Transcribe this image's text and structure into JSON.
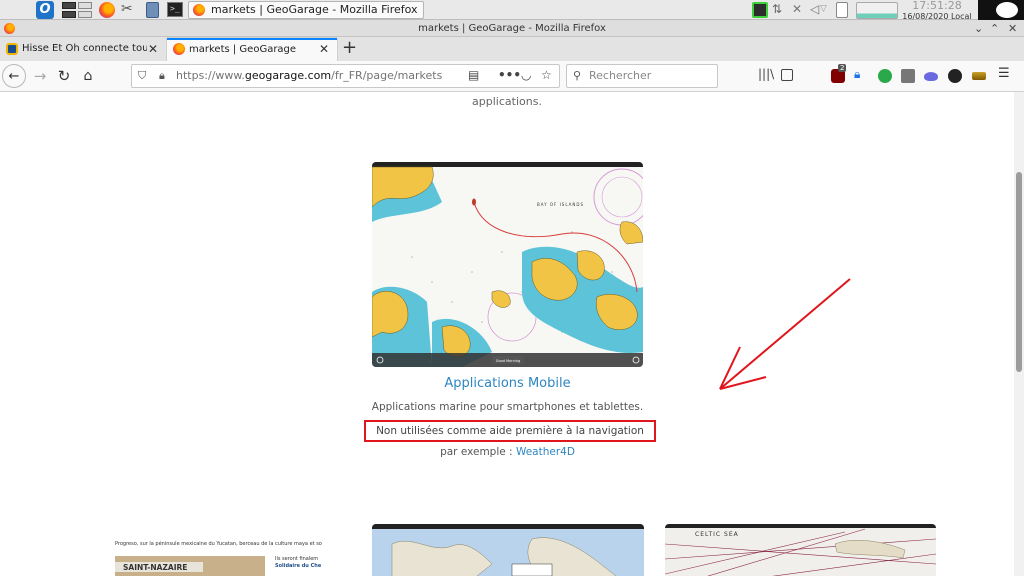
{
  "system_panel": {
    "taskbar_title": "markets | GeoGarage - Mozilla Firefox",
    "clock_time": "17:51:28",
    "clock_date": "16/08/2020 Local"
  },
  "window": {
    "title": "markets | GeoGarage - Mozilla Firefox"
  },
  "tabs": [
    {
      "label": "Hisse Et Oh connecte tous les",
      "active": false
    },
    {
      "label": "markets | GeoGarage",
      "active": true
    }
  ],
  "nav": {
    "url_prefix": "https://www.",
    "url_domain": "geogarage.com",
    "url_path": "/fr_FR/page/markets",
    "search_placeholder": "Rechercher",
    "badge_count": "2"
  },
  "page": {
    "intro_tail": "applications.",
    "feature": {
      "map_label": "BAY OF ISLANDS",
      "map_button": "Good Morning",
      "title": "Applications Mobile",
      "description": "Applications marine pour smartphones et tablettes.",
      "warning": "Non utilisées comme aide première à la navigation",
      "example_prefix": "par exemple : ",
      "example_link": "Weather4D"
    },
    "thumbnails": {
      "left_caption": "SAINT-NAZAIRE",
      "left_text": "Progreso, sur la péninsule mexicaine du Yucatan, berceau de la culture maya et so",
      "left_text2": "Ils seront finalem",
      "left_text3": "Solidaire du Che",
      "right_label": "CELTIC SEA"
    }
  },
  "colors": {
    "link": "#2e86c1",
    "annotation_red": "#e0161c",
    "tab_accent": "#0a84ff"
  }
}
